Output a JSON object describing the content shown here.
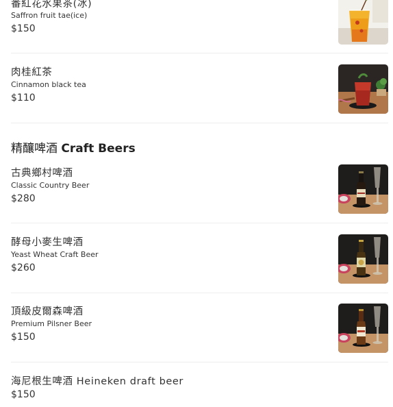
{
  "menu": {
    "items_top": [
      {
        "name_zh": "番紅花水果茶(冰)",
        "name_en": "Saffron fruit tae(ice)",
        "price": "$150",
        "image": "saffron-iced-fruit-tea-photo"
      },
      {
        "name_zh": "肉桂紅茶",
        "name_en": "Cinnamon black tea",
        "price": "$110",
        "image": "cinnamon-black-tea-photo"
      }
    ],
    "section": {
      "title_zh": "精釀啤酒",
      "title_en": "Craft Beers"
    },
    "beers": [
      {
        "name_zh": "古典鄉村啤酒",
        "name_en": "Classic Country Beer",
        "price": "$280",
        "image": "classic-country-beer-bottle-photo"
      },
      {
        "name_zh": "酵母小麥生啤酒",
        "name_en": "Yeast Wheat Craft Beer",
        "price": "$260",
        "image": "yeast-wheat-beer-bottle-photo"
      },
      {
        "name_zh": "頂級皮爾森啤酒",
        "name_en": "Premium Pilsner Beer",
        "price": "$150",
        "image": "premium-pilsner-beer-bottle-photo"
      },
      {
        "name": "海尼根生啤酒 Heineken draft beer",
        "price": "$150"
      }
    ]
  }
}
